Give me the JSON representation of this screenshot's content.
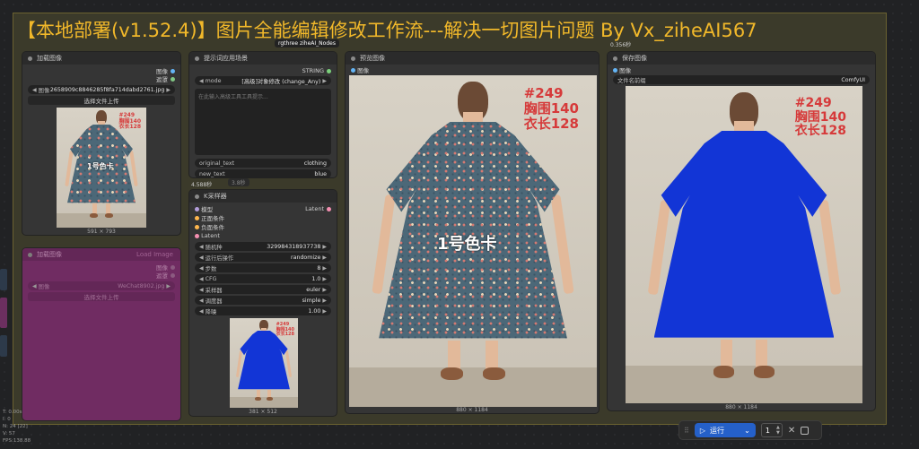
{
  "group": {
    "title": "【本地部署(v1.52.4)】图片全能编辑修改工作流---解决一切图片问题 By Vx_ziheAI567",
    "tag_left": "rgthree",
    "tag_right": "ziheAI_Nodes",
    "timer_preview": "0.356秒"
  },
  "load_image": {
    "title": "加载图像",
    "out_image": "图像",
    "out_mask": "遮罩",
    "image_label": "图像",
    "image_file": "2658909c8846285f8fa714dabd2761.jpg",
    "upload_label": "选择文件上传",
    "swatch_text": "1号色卡",
    "photo_text": [
      "#249",
      "胸围140",
      "衣长128"
    ],
    "dims": "591 × 793"
  },
  "load_image_muted": {
    "title": "加载图像",
    "subtitle": "Load Image",
    "out_image": "图像",
    "out_mask": "遮罩",
    "image_label": "图像",
    "image_file": "WeChat8902.jpg",
    "upload_label": "选择文件上传"
  },
  "prompt_node": {
    "title": "提示词应用场景",
    "out_string": "STRING",
    "mode_label": "mode",
    "mode_value": "[高级]对象修改 (change_Any)",
    "placeholder": "在此输入高级工具工具提示...",
    "original_text_label": "original_text",
    "original_text_value": "clothing",
    "new_text_label": "new_text",
    "new_text_value": "blue",
    "timer": "4.588秒",
    "below_tag": "3.8秒"
  },
  "ksampler": {
    "title": "K采样器",
    "in_model": "模型",
    "in_positive": "正面条件",
    "in_negative": "负面条件",
    "in_latent": "Latent",
    "out_latent": "Latent",
    "widgets": [
      {
        "label": "随机种",
        "value": "329984318937738"
      },
      {
        "label": "运行后操作",
        "value": "randomize"
      },
      {
        "label": "步数",
        "value": "8"
      },
      {
        "label": "CFG",
        "value": "1.0"
      },
      {
        "label": "采样器",
        "value": "euler"
      },
      {
        "label": "调度器",
        "value": "simple"
      },
      {
        "label": "降噪",
        "value": "1.00"
      }
    ],
    "photo_text": [
      "#249",
      "胸围140",
      "衣长128"
    ],
    "dims": "381 × 512"
  },
  "preview": {
    "title": "预览图像",
    "in_image": "图像",
    "photo_text": [
      "#249",
      "胸围140",
      "衣长128"
    ],
    "swatch_text": "1号色卡",
    "dims": "880 × 1184"
  },
  "save_image": {
    "title": "保存图像",
    "in_image": "图像",
    "prefix_label": "文件名前缀",
    "prefix_value": "ComfyUI",
    "photo_text": [
      "#249",
      "胸围140",
      "衣长128"
    ],
    "dims": "880 × 1184"
  },
  "runbar": {
    "run_label": "运行",
    "queue_count": "1"
  },
  "stats": [
    "T: 0.00s",
    "I: 0",
    "N: 24 [22]",
    "V: 57",
    "FPS:138.88"
  ],
  "colors": {
    "title": "#f1b82a",
    "run_button": "#2560c9",
    "blue_dress": "#1235d6",
    "muted_node": "#7a2a6c"
  }
}
